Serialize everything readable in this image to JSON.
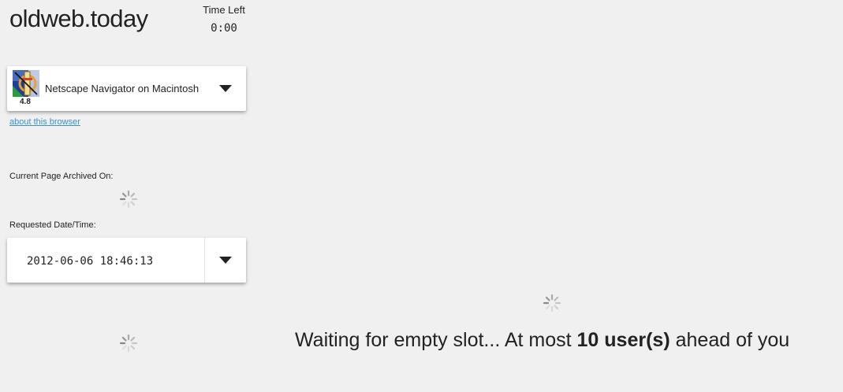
{
  "app": {
    "title": "oldweb.today"
  },
  "timer": {
    "label": "Time Left",
    "value": "0:00"
  },
  "browser": {
    "name": "Netscape Navigator on Macintosh",
    "version": "4.8",
    "icon": "netscape-navigator-icon",
    "about_link": "about this browser"
  },
  "archive": {
    "label": "Current Page Archived On:"
  },
  "requested": {
    "label": "Requested Date/Time:",
    "value": "2012-06-06 18:46:13"
  },
  "status": {
    "prefix": "Waiting for empty slot... At most ",
    "count": "10 user(s)",
    "suffix": " ahead of you"
  },
  "colors": {
    "background": "#f0f0f0",
    "link": "#3a8fd0",
    "panel": "#ffffff"
  }
}
